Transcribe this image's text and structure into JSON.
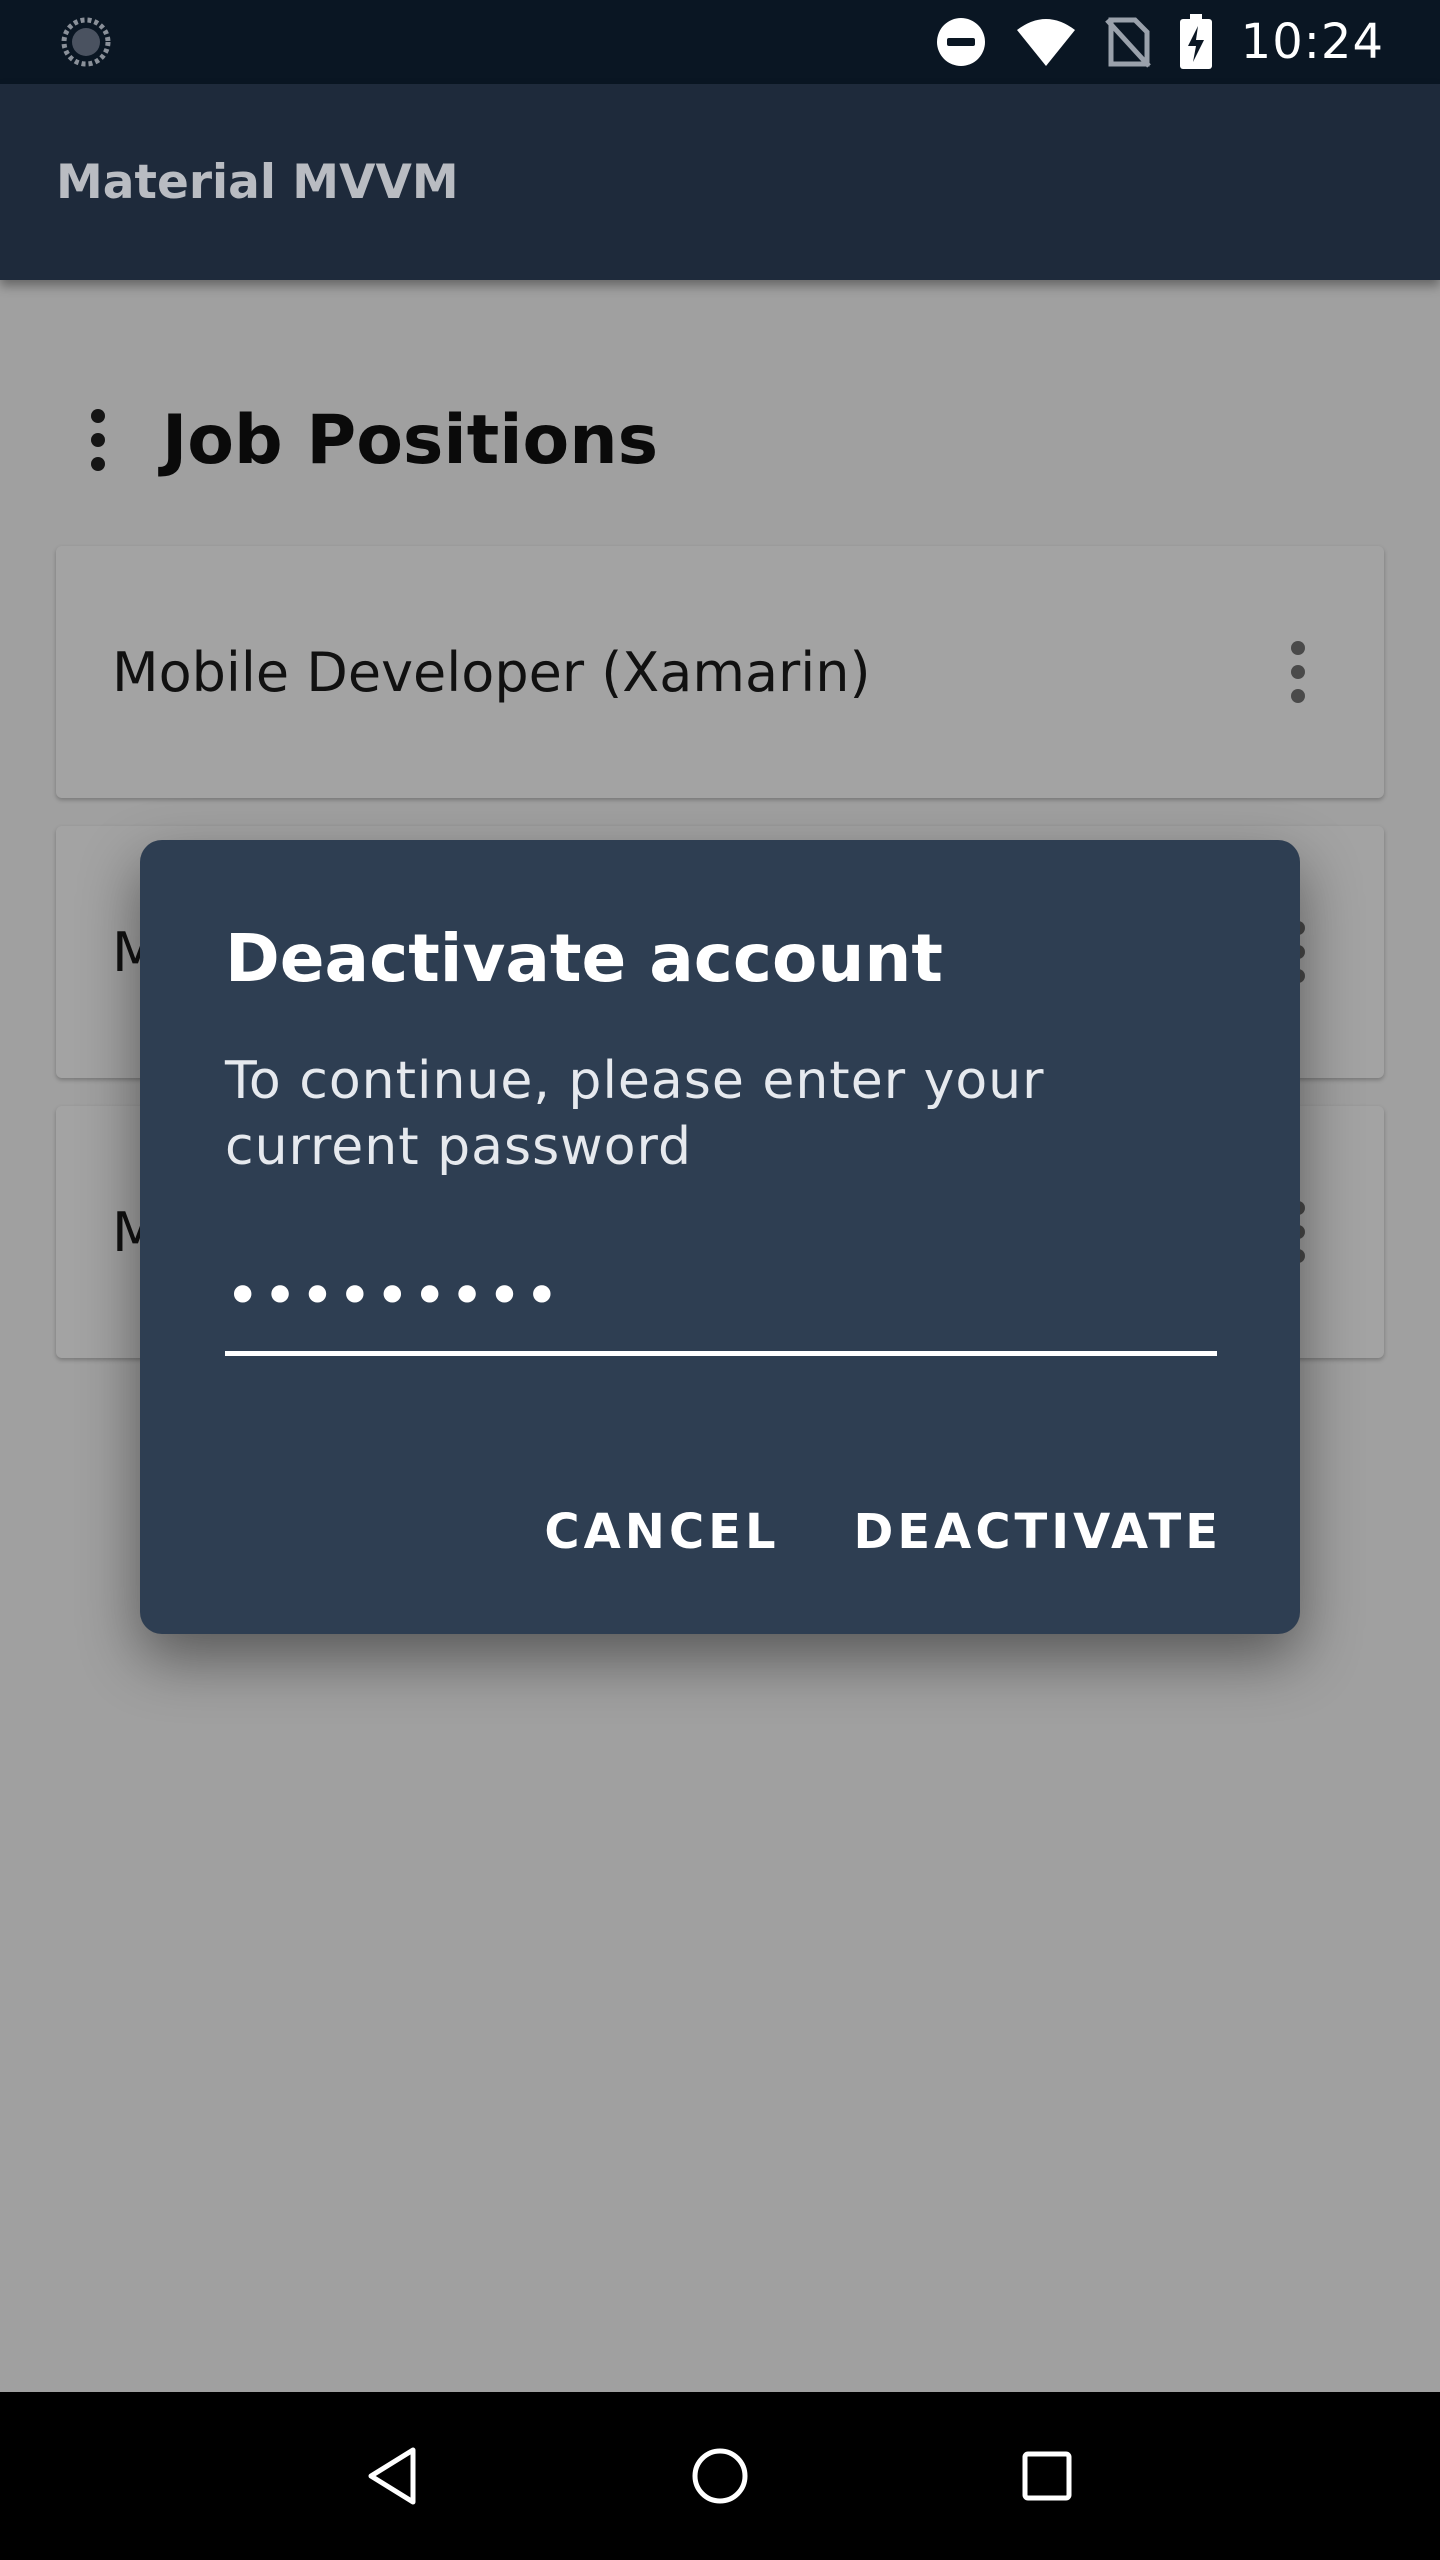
{
  "status_bar": {
    "time": "10:24",
    "icons": [
      "loading-icon",
      "do-not-disturb-icon",
      "wifi-icon",
      "no-sim-icon",
      "battery-charging-icon"
    ]
  },
  "app_bar": {
    "title": "Material MVVM"
  },
  "section": {
    "title": "Job Positions"
  },
  "cards": [
    {
      "title": "Mobile Developer (Xamarin)"
    },
    {
      "title": "M"
    },
    {
      "title": "M"
    }
  ],
  "dialog": {
    "title": "Deactivate account",
    "message": "To continue, please enter your current password",
    "password_value": "•••••••••",
    "cancel_label": "CANCEL",
    "deactivate_label": "DEACTIVATE"
  },
  "nav_bar": {
    "icons": [
      "back-icon",
      "home-icon",
      "recents-icon"
    ]
  },
  "colors": {
    "app_bar": "#1e2a3b",
    "status_bar": "#0a1623",
    "dialog": "#2e3e52"
  }
}
